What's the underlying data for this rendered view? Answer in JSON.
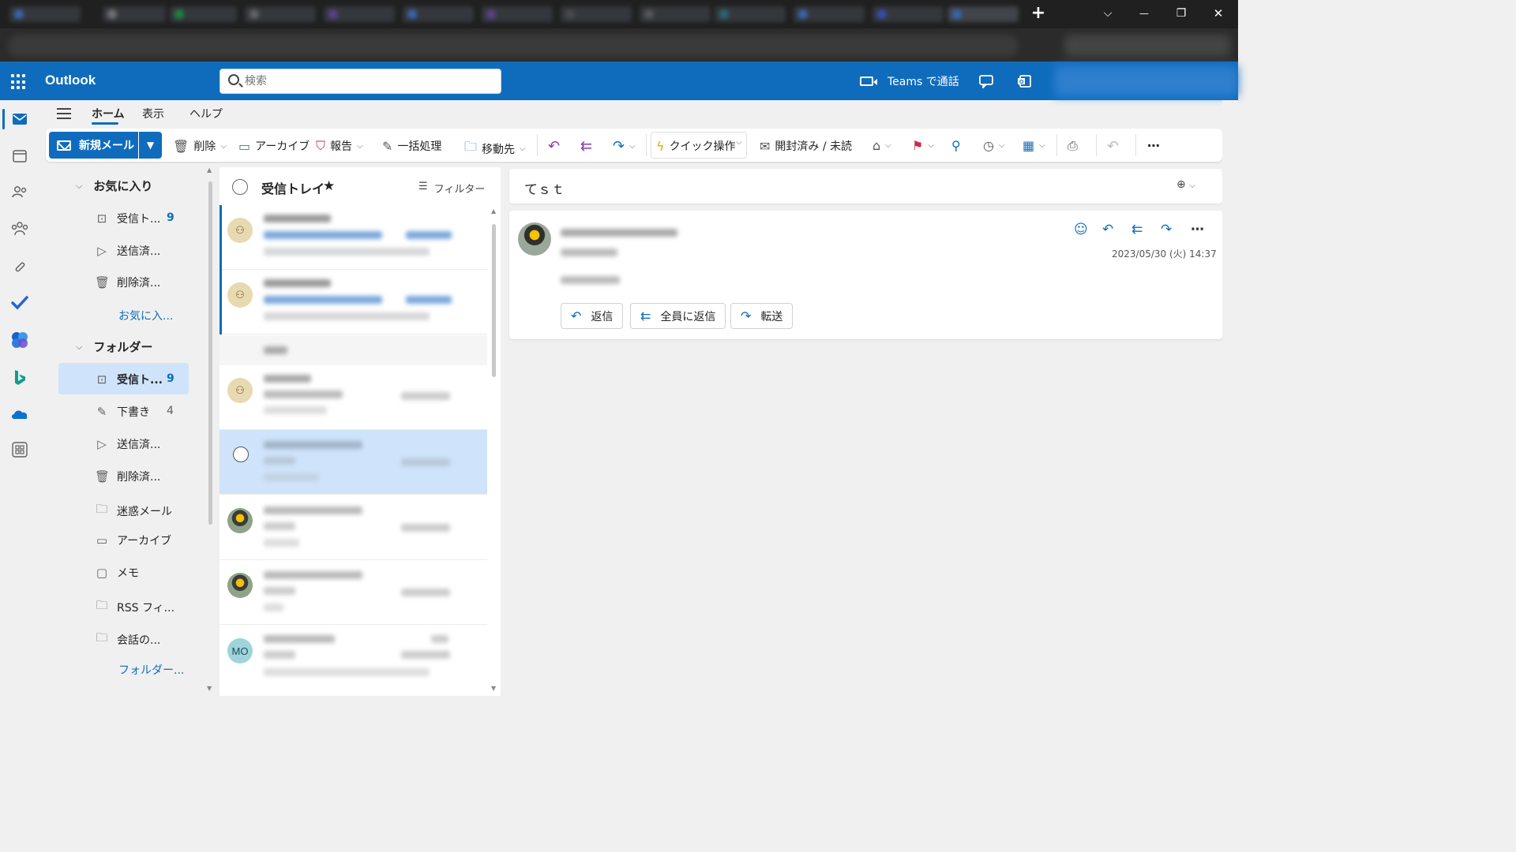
{
  "window": {
    "new_tab": "+",
    "tab_list": "⌵",
    "minimize": "—",
    "restore": "❐",
    "close": "✕"
  },
  "header": {
    "brand": "Outlook",
    "search_placeholder": "検索",
    "teams_call": "Teams で通話"
  },
  "ribbon": {
    "tabs": [
      "ホーム",
      "表示",
      "ヘルプ"
    ],
    "new_mail": "新規メール",
    "delete": "削除",
    "archive": "アーカイブ",
    "report": "報告",
    "sweep": "一括処理",
    "move_to": "移動先",
    "quick_steps": "クイック操作",
    "read_unread": "開封済み / 未読"
  },
  "folders": {
    "favorites_header": "お気に入り",
    "favorites": [
      {
        "label": "受信ト...",
        "count": "9"
      },
      {
        "label": "送信済...",
        "count": ""
      },
      {
        "label": "削除済...",
        "count": ""
      }
    ],
    "favorites_more": "お気に入...",
    "folders_header": "フォルダー",
    "items": [
      {
        "label": "受信ト...",
        "count": "9"
      },
      {
        "label": "下書き",
        "count": "4"
      },
      {
        "label": "送信済...",
        "count": ""
      },
      {
        "label": "削除済...",
        "count": ""
      },
      {
        "label": "迷惑メール",
        "count": ""
      },
      {
        "label": "アーカイブ",
        "count": ""
      },
      {
        "label": "メモ",
        "count": ""
      },
      {
        "label": "RSS フィ...",
        "count": ""
      },
      {
        "label": "会話の...",
        "count": ""
      }
    ],
    "folders_more": "フォルダー..."
  },
  "message_list": {
    "title": "受信トレイ",
    "filter": "フィルター",
    "avatar_initials": "MO"
  },
  "reading": {
    "subject": "てｓｔ",
    "date": "2023/05/30 (火) 14:37",
    "reply": "返信",
    "reply_all": "全員に返信",
    "forward": "転送"
  },
  "colors": {
    "brand_blue": "#0f6cbd",
    "selected_bg": "#cfe4fa"
  }
}
